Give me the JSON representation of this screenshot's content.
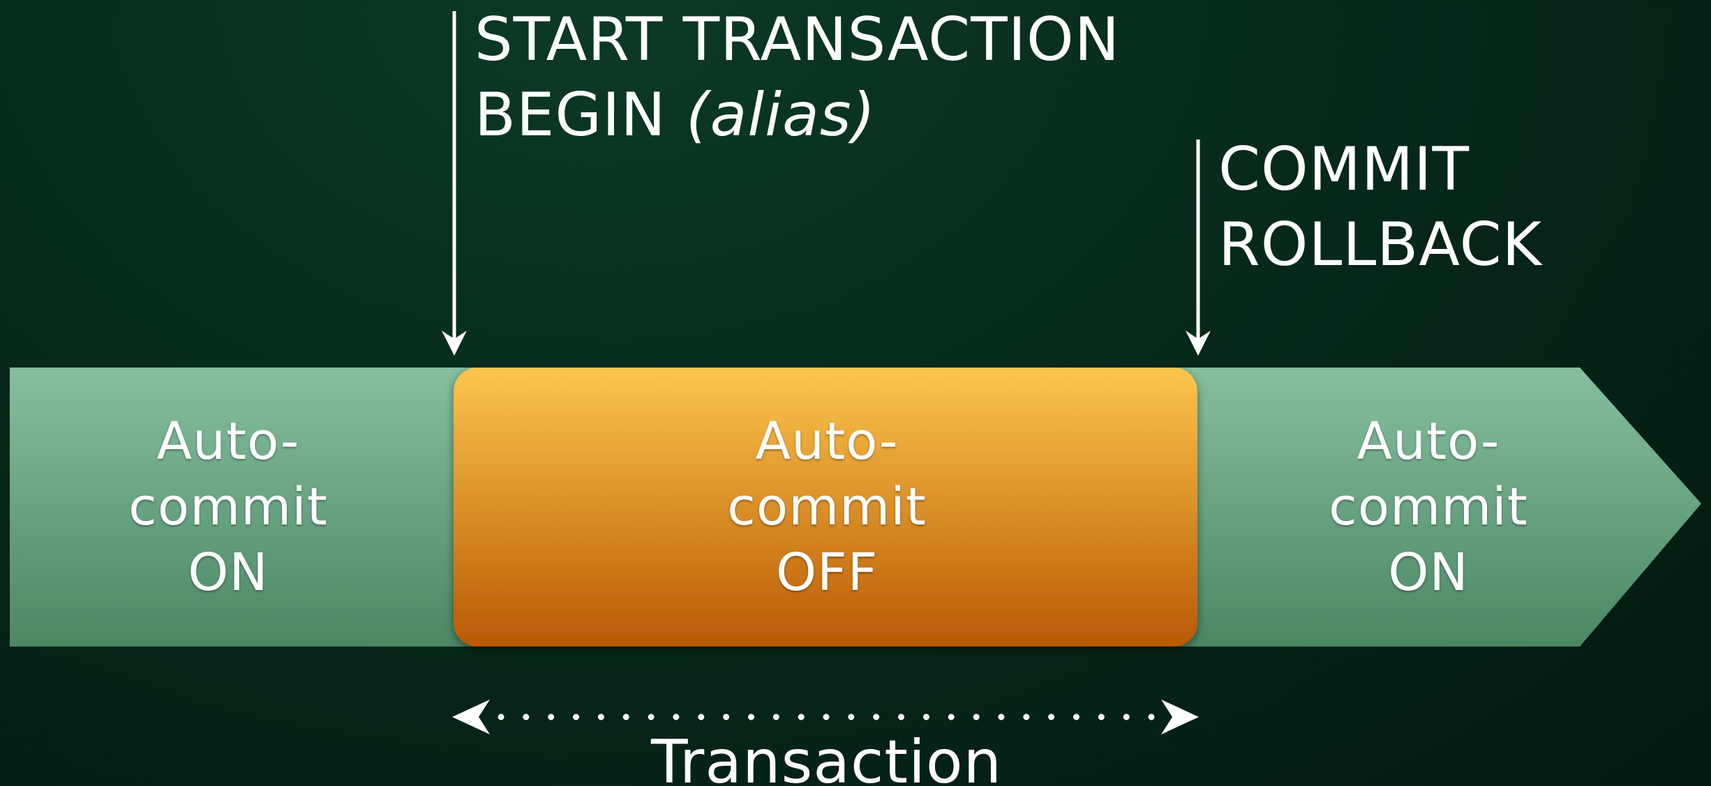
{
  "start_label": {
    "line1": "START TRANSACTION",
    "line2_main": "BEGIN",
    "line2_alias": "(alias)"
  },
  "end_label": {
    "line1": "COMMIT",
    "line2": "ROLLBACK"
  },
  "states": {
    "left": {
      "line1": "Auto-",
      "line2": "commit",
      "line3": "ON"
    },
    "middle": {
      "line1": "Auto-",
      "line2": "commit",
      "line3": "OFF"
    },
    "right": {
      "line1": "Auto-",
      "line2": "commit",
      "line3": "ON"
    }
  },
  "transaction_label": "Transaction",
  "colors": {
    "green_light": "#86bf9f",
    "green_dark": "#4b8763",
    "orange_light": "#fcc64d",
    "orange_dark": "#b95904",
    "arrow": "#ffffff"
  }
}
